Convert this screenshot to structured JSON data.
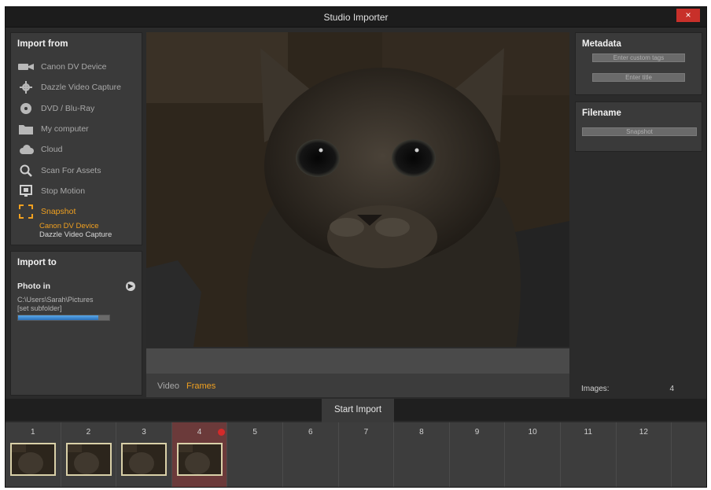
{
  "window": {
    "title": "Studio Importer",
    "close_label": "×"
  },
  "import_from": {
    "title": "Import from",
    "items": [
      {
        "label": "Canon DV Device",
        "icon": "camcorder-icon"
      },
      {
        "label": "Dazzle Video Capture",
        "icon": "gear-icon"
      },
      {
        "label": "DVD / Blu-Ray",
        "icon": "disc-icon"
      },
      {
        "label": "My computer",
        "icon": "folder-icon"
      },
      {
        "label": "Cloud",
        "icon": "cloud-icon"
      },
      {
        "label": "Scan For Assets",
        "icon": "search-icon"
      },
      {
        "label": "Stop Motion",
        "icon": "stop-motion-icon"
      },
      {
        "label": "Snapshot",
        "icon": "snapshot-icon"
      }
    ],
    "sub_items": [
      "Canon DV Device",
      "Dazzle Video Capture"
    ]
  },
  "import_to": {
    "title": "Import to",
    "folder_label": "Photo in",
    "path": "C:\\Users\\Sarah\\Pictures",
    "subfolder": "[set subfolder]",
    "storage_used": 0.88
  },
  "mode_tabs": {
    "video": "Video",
    "frames": "Frames"
  },
  "metadata": {
    "title": "Metadata",
    "button_1": "Enter custom tags",
    "button_2": "Enter title"
  },
  "filename": {
    "title": "Filename",
    "value": "Snapshot"
  },
  "images": {
    "label": "Images:",
    "count": "4"
  },
  "start_import_label": "Start Import",
  "filmstrip": {
    "slots": [
      "1",
      "2",
      "3",
      "4",
      "5",
      "6",
      "7",
      "8",
      "9",
      "10",
      "11",
      "12"
    ],
    "selected": "4",
    "thumbnails": 4
  },
  "colors": {
    "accent": "#f0a020",
    "close": "#c8302a",
    "selected_slot": "#6b3a3a",
    "record_dot": "#d42a2a"
  }
}
